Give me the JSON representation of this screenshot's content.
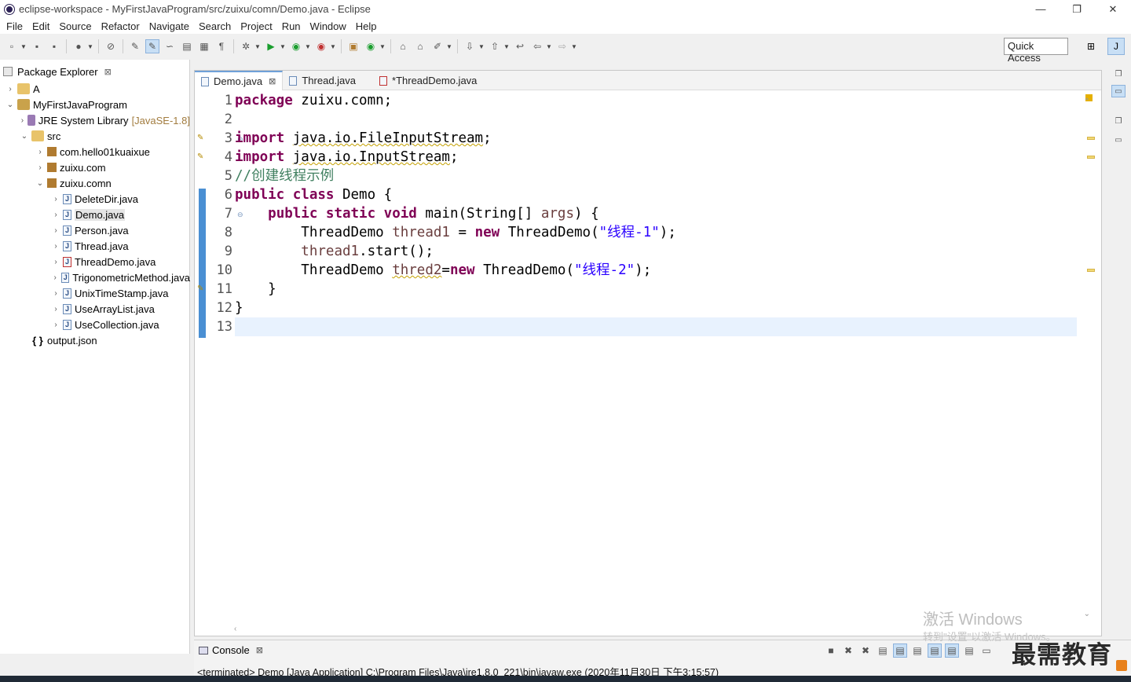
{
  "window": {
    "title": "eclipse-workspace - MyFirstJavaProgram/src/zuixu/comn/Demo.java - Eclipse",
    "minimize": "—",
    "restore": "❐",
    "close": "✕"
  },
  "menu": [
    "File",
    "Edit",
    "Source",
    "Refactor",
    "Navigate",
    "Search",
    "Project",
    "Run",
    "Window",
    "Help"
  ],
  "toolbar": {
    "quick_access": "Quick Access"
  },
  "explorer": {
    "title": "Package Explorer",
    "close": "⊠",
    "items": [
      {
        "label": "A",
        "arrow": "›",
        "icon": "project-icon"
      },
      {
        "label": "MyFirstJavaProgram",
        "arrow": "⌄",
        "icon": "project-icon"
      },
      {
        "label": "JRE System Library",
        "extra": "[JavaSE-1.8]",
        "arrow": "›",
        "icon": "library-icon"
      },
      {
        "label": "src",
        "arrow": "⌄",
        "icon": "source-folder-icon"
      },
      {
        "label": "com.hello01kuaixue",
        "arrow": "›",
        "icon": "package-icon"
      },
      {
        "label": "zuixu.com",
        "arrow": "›",
        "icon": "package-icon"
      },
      {
        "label": "zuixu.comn",
        "arrow": "⌄",
        "icon": "package-icon"
      },
      {
        "label": "DeleteDir.java",
        "arrow": "›",
        "icon": "java-file-icon"
      },
      {
        "label": "Demo.java",
        "arrow": "›",
        "icon": "java-file-icon"
      },
      {
        "label": "Person.java",
        "arrow": "›",
        "icon": "java-file-icon"
      },
      {
        "label": "Thread.java",
        "arrow": "›",
        "icon": "java-file-icon"
      },
      {
        "label": "ThreadDemo.java",
        "arrow": "›",
        "icon": "java-file-icon"
      },
      {
        "label": "TrigonometricMethod.java",
        "arrow": "›",
        "icon": "java-file-icon"
      },
      {
        "label": "UnixTimeStamp.java",
        "arrow": "›",
        "icon": "java-file-icon"
      },
      {
        "label": "UseArrayList.java",
        "arrow": "›",
        "icon": "java-file-icon"
      },
      {
        "label": "UseCollection.java",
        "arrow": "›",
        "icon": "java-file-icon"
      },
      {
        "label": "output.json",
        "arrow": "",
        "icon": "json-file-icon"
      }
    ]
  },
  "editor": {
    "tabs": [
      {
        "label": "Demo.java",
        "close": "⊠"
      },
      {
        "label": "Thread.java"
      },
      {
        "label": "*ThreadDemo.java"
      }
    ],
    "lines": [
      "1",
      "2",
      "3",
      "4",
      "5",
      "6",
      "7",
      "8",
      "9",
      "10",
      "11",
      "12",
      "13"
    ],
    "code": {
      "l1_kw": "package",
      "l1_rest": " zuixu.comn;",
      "l3_kw": "import",
      "l3_rest": "java.io.FileInputStream",
      "l3_end": ";",
      "l4_kw": "import",
      "l4_rest": "java.io.InputStream",
      "l4_end": ";",
      "l5_comment": "//创建线程示例",
      "l6_kw": "public class",
      "l6_rest": " Demo {",
      "l7_kw": "public static void",
      "l7_rest": " main(String[] ",
      "l7_var": "args",
      "l7_end": ") {",
      "l8_type": "ThreadDemo ",
      "l8_var": "thread1",
      "l8_eq": " = ",
      "l8_kw": "new",
      "l8_call": " ThreadDemo(",
      "l8_str": "\"线程-1\"",
      "l8_end": ");",
      "l9_var": "thread1",
      "l9_rest": ".start();",
      "l10_type": "ThreadDemo ",
      "l10_var": "thred2",
      "l10_eq": "=",
      "l10_kw": "new",
      "l10_call": " ThreadDemo(",
      "l10_str": "\"线程-2\"",
      "l10_end": ");",
      "l11": "}",
      "l12": "}"
    }
  },
  "console": {
    "title": "Console",
    "close": "⊠",
    "status": "<terminated> Demo [Java Application] C:\\Program Files\\Java\\jre1.8.0_221\\bin\\javaw.exe (2020年11月30日 下午3:15:57)"
  },
  "overlay": {
    "activate_windows": "激活 Windows",
    "activate_hint": "转到\"设置\"以激活 Windows。",
    "logo": "最需教育"
  },
  "colors": {
    "keyword": "#7f0055",
    "comment": "#3f7f5f",
    "string": "#2a00ff",
    "variable": "#6a3e3e",
    "current_line": "#e8f2fe",
    "change_bar": "#4a8fd3"
  }
}
